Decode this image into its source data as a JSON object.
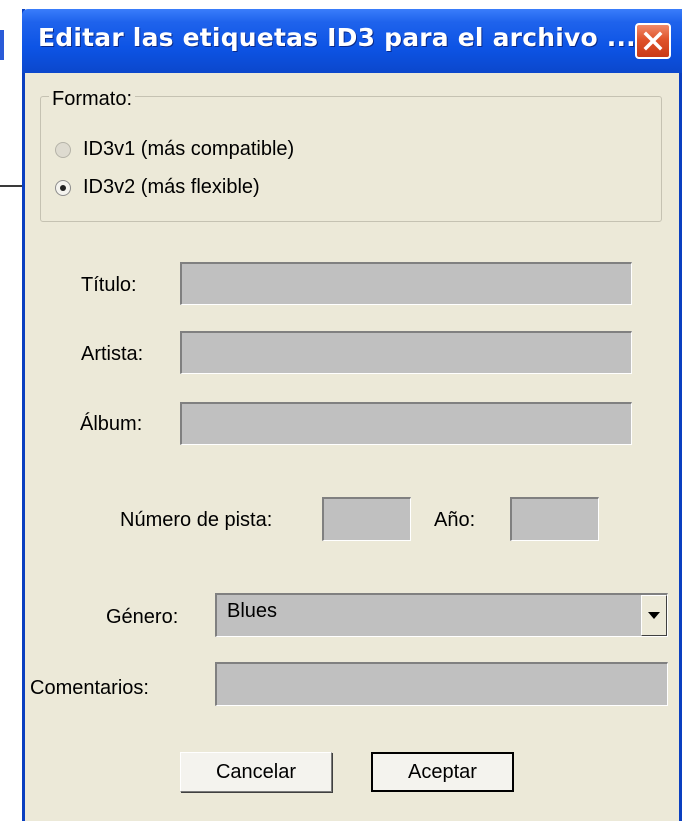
{
  "window": {
    "title": "Editar las etiquetas ID3 para el archivo ..."
  },
  "format_group": {
    "legend": "Formato:",
    "options": [
      {
        "label": "ID3v1 (más compatible)",
        "selected": false,
        "enabled": false
      },
      {
        "label": "ID3v2 (más flexible)",
        "selected": true,
        "enabled": true
      }
    ]
  },
  "fields": {
    "title_label": "Título:",
    "title_value": "",
    "artist_label": "Artista:",
    "artist_value": "",
    "album_label": "Álbum:",
    "album_value": "",
    "track_label": "Número de pista:",
    "track_value": "",
    "year_label": "Año:",
    "year_value": "",
    "genre_label": "Género:",
    "genre_value": "Blues",
    "comments_label": "Comentarios:",
    "comments_value": ""
  },
  "buttons": {
    "cancel": "Cancelar",
    "ok": "Aceptar"
  },
  "colors": {
    "titlebar": "#0d54e5",
    "dialog_bg": "#ece9d8",
    "field_bg": "#c0c0c0",
    "close": "#e0532a"
  },
  "icons": {
    "close": "close-icon",
    "dropdown": "chevron-down-icon"
  }
}
